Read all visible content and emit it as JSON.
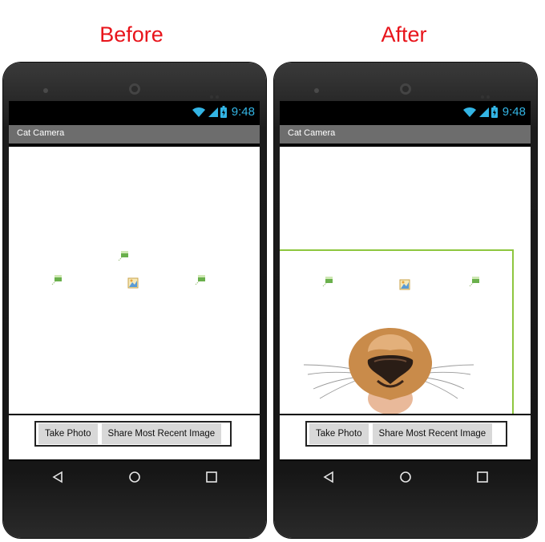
{
  "labels": {
    "before": "Before",
    "after": "After"
  },
  "device": {
    "time": "9:48",
    "app_title": "Cat Camera"
  },
  "buttons": {
    "take_photo": "Take Photo",
    "share_recent": "Share Most Recent Image"
  },
  "icons": {
    "wifi": "wifi-icon",
    "signal": "cell-signal-icon",
    "battery": "battery-icon",
    "back": "back-icon",
    "home": "home-icon",
    "recents": "recents-icon",
    "image_placeholder": "image-placeholder-icon",
    "cat_nose": "cat-nose-image"
  },
  "colors": {
    "caption": "#e8141b",
    "clock": "#33b5e5",
    "appbar": "#6d6d6d",
    "frame": "#8ec63f"
  }
}
